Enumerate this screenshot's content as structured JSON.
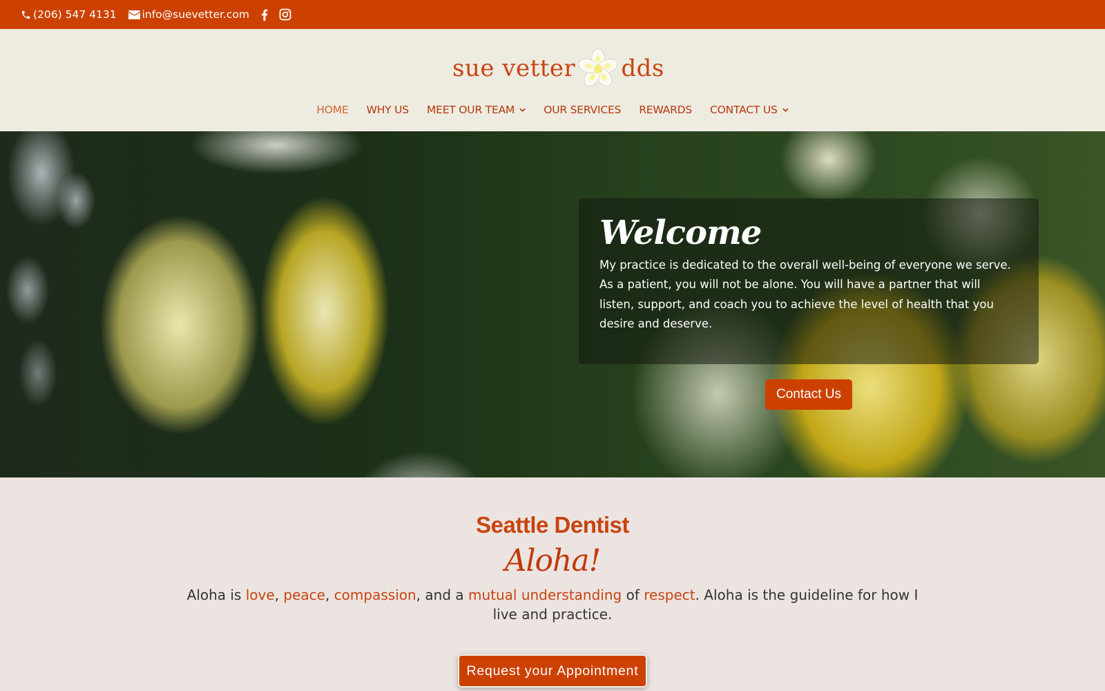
{
  "topbar": {
    "phone": "(206) 547 4131",
    "email": "info@suevetter.com",
    "phone_icon": "phone-icon",
    "email_icon": "envelope-icon",
    "social": [
      "facebook-icon",
      "instagram-icon"
    ]
  },
  "header": {
    "logo_left": "sue vetter",
    "logo_right": "dds",
    "logo_icon": "plumeria-flower-icon"
  },
  "nav": {
    "items": [
      {
        "label": "HOME",
        "active": true,
        "has_dropdown": false
      },
      {
        "label": "WHY US",
        "active": false,
        "has_dropdown": false
      },
      {
        "label": "MEET OUR TEAM",
        "active": false,
        "has_dropdown": true
      },
      {
        "label": "OUR SERVICES",
        "active": false,
        "has_dropdown": false
      },
      {
        "label": "REWARDS",
        "active": false,
        "has_dropdown": false
      },
      {
        "label": "CONTACT US",
        "active": false,
        "has_dropdown": true
      }
    ],
    "chevron": "⌄"
  },
  "hero": {
    "title": "Welcome",
    "text": "My practice is dedicated to the overall well-being of everyone we serve. As a patient, you will not be alone. You will have a partner that will listen, support, and coach you to achieve the level of health that you desire and deserve.",
    "button_label": "Contact Us"
  },
  "content": {
    "heading": "Seattle Dentist",
    "subheading": "Aloha!",
    "paragraph": {
      "p1": "Aloha is ",
      "love": "love",
      "c1": ", ",
      "peace": "peace",
      "c2": ", ",
      "compassion": "compassion",
      "p2": ", and a ",
      "mutual": "mutual understanding",
      "p3": " of ",
      "respect": "respect",
      "p4": ".  Aloha is the guideline for how I live and practice."
    },
    "cta_label": "Request your Appointment"
  },
  "colors": {
    "brand_orange": "#cc4100",
    "header_bg": "#eeebe1",
    "content_bg": "#ece4e1",
    "link_orange": "#c8440f"
  }
}
